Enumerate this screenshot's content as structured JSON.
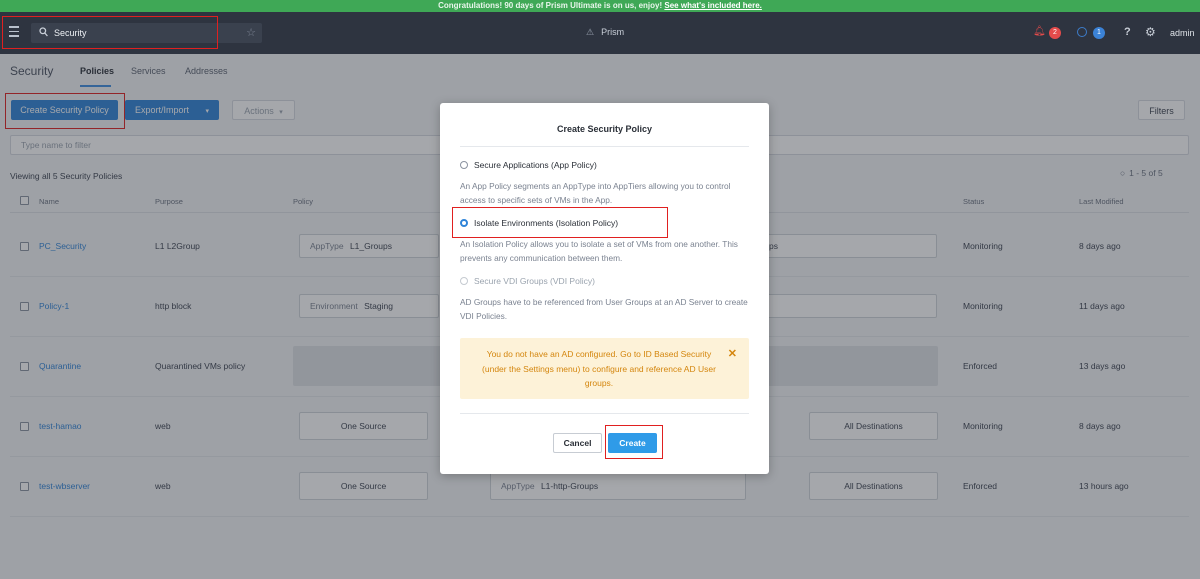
{
  "banner": {
    "text": "Congratulations! 90 days of Prism Ultimate is on us, enjoy!",
    "link": "See what's included here."
  },
  "topbar": {
    "search_value": "Security",
    "app_name": "Prism",
    "alerts_count": "2",
    "tasks_count": "1",
    "help": "?",
    "user": "admin"
  },
  "nav": {
    "section": "Security",
    "tabs": [
      "Policies",
      "Services",
      "Addresses"
    ],
    "active_tab": "Policies"
  },
  "toolbar": {
    "create": "Create Security Policy",
    "export": "Export/Import",
    "actions": "Actions",
    "filters": "Filters"
  },
  "filter": {
    "placeholder": "Type name to filter"
  },
  "summary": {
    "viewing": "Viewing all 5 Security Policies",
    "paging": "1 - 5 of 5"
  },
  "table": {
    "columns": [
      "Name",
      "Purpose",
      "Policy",
      "Status",
      "Last Modified"
    ],
    "rows": [
      {
        "name": "PC_Security",
        "purpose": "L1 L2Group",
        "policy_label": "AppType",
        "policy_value": "L1_Groups",
        "dest": "ps",
        "status": "Monitoring",
        "modified": "8 days ago"
      },
      {
        "name": "Policy-1",
        "purpose": "http block",
        "policy_label": "Environment",
        "policy_value": "Staging",
        "dest": "",
        "status": "Monitoring",
        "modified": "11 days ago"
      },
      {
        "name": "Quarantine",
        "purpose": "Quarantined VMs policy",
        "policy_label": "",
        "policy_value": "",
        "dest": "",
        "status": "Enforced",
        "modified": "13 days ago"
      },
      {
        "name": "test-hamao",
        "purpose": "web",
        "policy_label": "One Source",
        "policy_value": "",
        "dest": "All Destinations",
        "status": "Monitoring",
        "modified": "8 days ago"
      },
      {
        "name": "test-wbserver",
        "purpose": "web",
        "policy_label": "One Source",
        "policy_value": "",
        "mid_label": "AppType",
        "mid_value": "L1-http-Groups",
        "dest": "All Destinations",
        "status": "Enforced",
        "modified": "13 hours ago"
      }
    ]
  },
  "modal": {
    "title": "Create Security Policy",
    "options": [
      {
        "label": "Secure Applications (App Policy)",
        "desc": "An App Policy segments an AppType into AppTiers allowing you to control access to specific sets of VMs in the App.",
        "selected": false,
        "disabled": false
      },
      {
        "label": "Isolate Environments (Isolation Policy)",
        "desc": "An Isolation Policy allows you to isolate a set of VMs from one another. This prevents any communication between them.",
        "selected": true,
        "disabled": false
      },
      {
        "label": "Secure VDI Groups (VDI Policy)",
        "desc": "AD Groups have to be referenced from User Groups at an AD Server to create VDI Policies.",
        "selected": false,
        "disabled": true
      }
    ],
    "warning": "You do not have an AD configured. Go to ID Based Security (under the Settings menu) to configure and reference AD User groups.",
    "cancel": "Cancel",
    "create": "Create"
  },
  "colors": {
    "accent": "#2f84d8",
    "banner": "#3fa856",
    "topbar": "#2e3440",
    "highlight": "#e02020",
    "warning_bg": "#fdf2d8",
    "warning_text": "#d4860e"
  },
  "icons": [
    "hamburger-menu-icon",
    "search-icon",
    "star-icon",
    "prism-icon",
    "bell-icon",
    "task-icon",
    "help-icon",
    "gear-icon",
    "close-icon",
    "chevron-down-icon"
  ]
}
